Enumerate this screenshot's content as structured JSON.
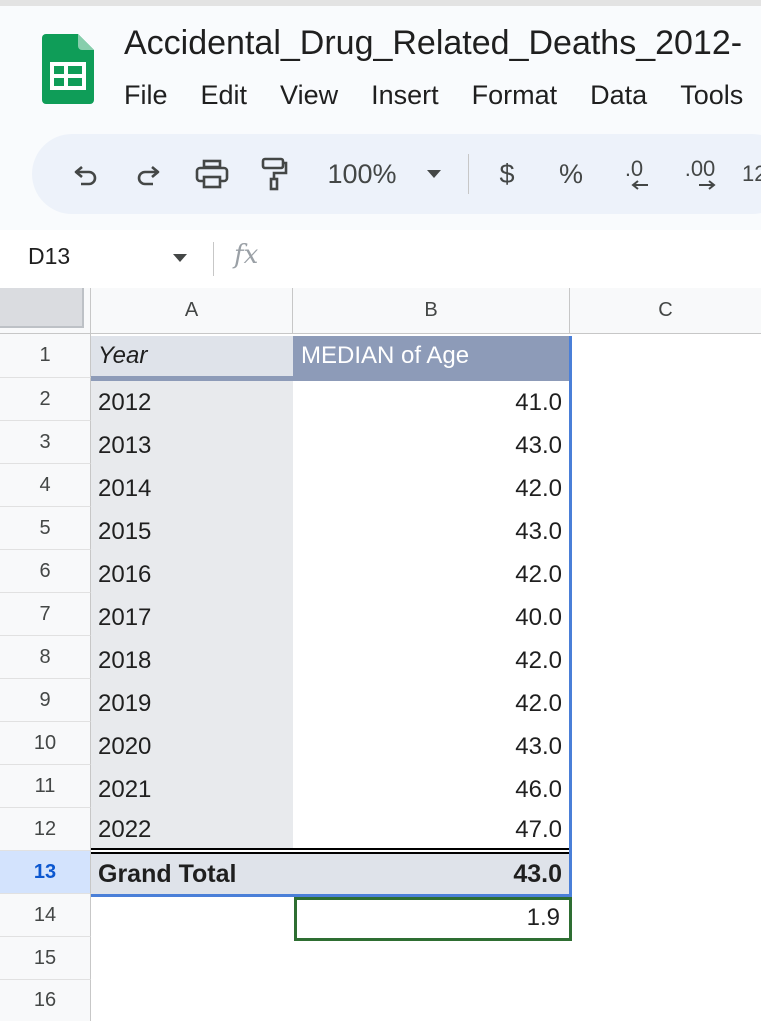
{
  "app": {
    "doc_title": "Accidental_Drug_Related_Deaths_2012-",
    "brand_color": "#0f9d58"
  },
  "menu": [
    "File",
    "Edit",
    "View",
    "Insert",
    "Format",
    "Data",
    "Tools"
  ],
  "toolbar": {
    "zoom": "100%",
    "currency": "$",
    "percent": "%",
    "decrease_decimals": ".0",
    "increase_decimals": ".00",
    "more_formats": "12"
  },
  "formula_bar": {
    "name_box": "D13",
    "fx": "fx",
    "value": ""
  },
  "columns": [
    "A",
    "B",
    "C"
  ],
  "rows": [
    "1",
    "2",
    "3",
    "4",
    "5",
    "6",
    "7",
    "8",
    "9",
    "10",
    "11",
    "12",
    "13",
    "14",
    "15",
    "16"
  ],
  "pivot": {
    "header": {
      "year": "Year",
      "median": "MEDIAN of Age"
    },
    "data": [
      {
        "year": "2012",
        "median": "41.0"
      },
      {
        "year": "2013",
        "median": "43.0"
      },
      {
        "year": "2014",
        "median": "42.0"
      },
      {
        "year": "2015",
        "median": "43.0"
      },
      {
        "year": "2016",
        "median": "42.0"
      },
      {
        "year": "2017",
        "median": "40.0"
      },
      {
        "year": "2018",
        "median": "42.0"
      },
      {
        "year": "2019",
        "median": "42.0"
      },
      {
        "year": "2020",
        "median": "43.0"
      },
      {
        "year": "2021",
        "median": "46.0"
      },
      {
        "year": "2022",
        "median": "47.0"
      }
    ],
    "total": {
      "label": "Grand Total",
      "median": "43.0"
    }
  },
  "cell_b14": "1.9"
}
